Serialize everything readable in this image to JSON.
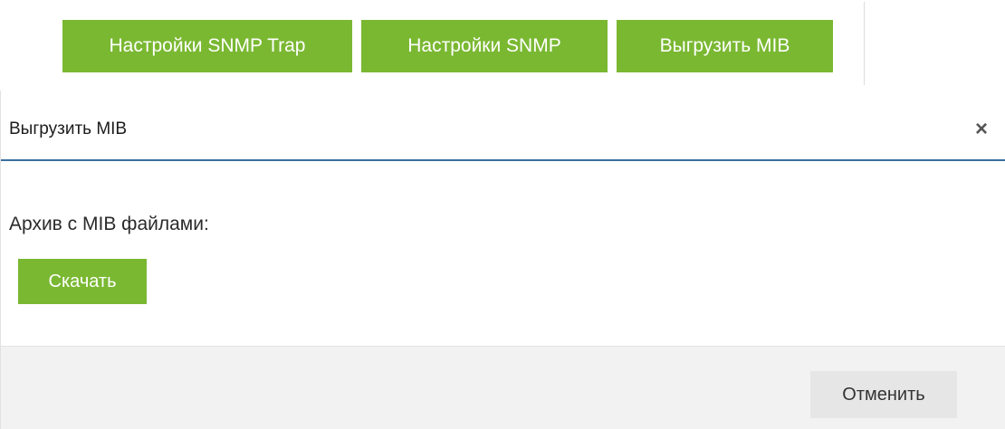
{
  "toolbar": {
    "buttons": [
      {
        "label": "Настройки SNMP Trap"
      },
      {
        "label": "Настройки SNMP"
      },
      {
        "label": "Выгрузить MIB"
      }
    ]
  },
  "modal": {
    "title": "Выгрузить MIB",
    "close_glyph": "×",
    "body": {
      "archive_label": "Архив с MIB файлами:",
      "download_label": "Скачать"
    },
    "footer": {
      "cancel_label": "Отменить"
    }
  },
  "colors": {
    "accent_green": "#7ab832",
    "header_border_blue": "#3b6e9e",
    "footer_bg": "#f2f2f2"
  },
  "icons": {
    "close": "close-icon"
  }
}
